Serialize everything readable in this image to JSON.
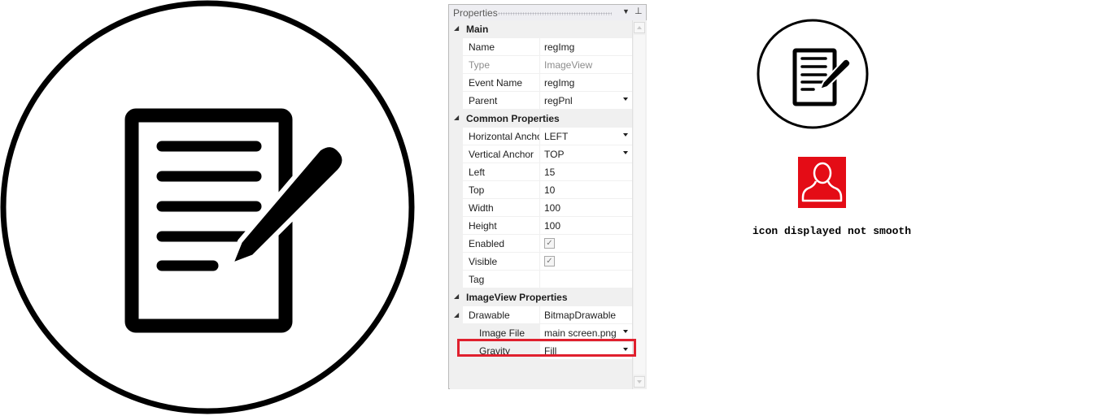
{
  "panel": {
    "title": "Properties",
    "menu_glyph": "▼",
    "pin_glyph": "⊥",
    "categories": [
      {
        "label": "Main",
        "arrow": "◢"
      },
      {
        "label": "Common Properties",
        "arrow": "◢"
      },
      {
        "label": "ImageView Properties",
        "arrow": "◢"
      }
    ],
    "rows": [
      {
        "name": "Name",
        "value": "regImg"
      },
      {
        "name": "Type",
        "value": "ImageView"
      },
      {
        "name": "Event Name",
        "value": "regImg"
      },
      {
        "name": "Parent",
        "value": "regPnl",
        "dropdown": true
      },
      {
        "name": "Horizontal Anchor",
        "value": "LEFT",
        "dropdown": true
      },
      {
        "name": "Vertical Anchor",
        "value": "TOP",
        "dropdown": true
      },
      {
        "name": "Left",
        "value": "15"
      },
      {
        "name": "Top",
        "value": "10"
      },
      {
        "name": "Width",
        "value": "100"
      },
      {
        "name": "Height",
        "value": "100"
      },
      {
        "name": "Enabled",
        "checked": true
      },
      {
        "name": "Visible",
        "checked": true
      },
      {
        "name": "Tag",
        "value": ""
      },
      {
        "name": "Drawable",
        "value": "BitmapDrawable"
      },
      {
        "name": "Image File",
        "value": "main screen.png",
        "dropdown": true
      },
      {
        "name": "Gravity",
        "value": "Fill",
        "dropdown": true
      }
    ],
    "check_glyph": "✓"
  },
  "annotation": {
    "caption": "icon displayed not smooth",
    "highlight_color": "#e0202e"
  },
  "icons": {
    "big": "document-edit-icon",
    "small": "document-edit-icon",
    "red": "user-icon",
    "red_color": "#e40c16"
  }
}
